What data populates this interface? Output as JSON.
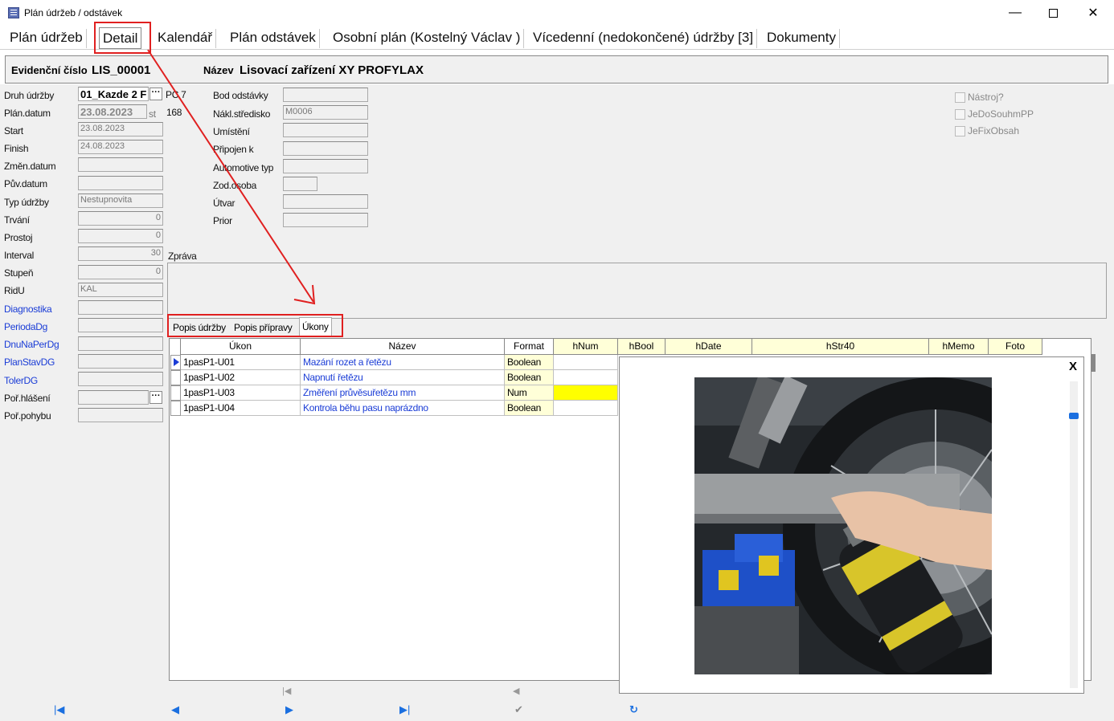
{
  "window": {
    "title": "Plán údržeb / odstávek",
    "min_glyph": "—",
    "close_glyph": "✕"
  },
  "main_tabs": [
    {
      "label": "Plán údržeb"
    },
    {
      "label": "Detail"
    },
    {
      "label": "Kalendář"
    },
    {
      "label": "Plán odstávek"
    },
    {
      "label": "Osobní plán (Kostelný Václav )"
    },
    {
      "label": "Vícedenní (nedokončené) údržby [3]"
    },
    {
      "label": "Dokumenty"
    }
  ],
  "header": {
    "evid_label": "Evidenční číslo",
    "evid_value": "LIS_00001",
    "name_label": "Název",
    "name_value": "Lisovací zařízení XY PROFYLAX"
  },
  "left_fields": [
    {
      "label": "Druh údržby",
      "value": "01_Kazde 2 F"
    },
    {
      "label": "Plán.datum",
      "value": "23.08.2023"
    },
    {
      "label": "Start",
      "value": "23.08.2023"
    },
    {
      "label": "Finish",
      "value": "24.08.2023"
    },
    {
      "label": "Změn.datum",
      "value": ""
    },
    {
      "label": "Pův.datum",
      "value": ""
    },
    {
      "label": "Typ údržby",
      "value": "Nestupnovita"
    },
    {
      "label": "Trvání",
      "value": "0"
    },
    {
      "label": "Prostoj",
      "value": "0"
    },
    {
      "label": "Interval",
      "value": "30"
    },
    {
      "label": "Stupeň",
      "value": "0"
    },
    {
      "label": "RidU",
      "value": "KAL"
    },
    {
      "label": "Diagnostika",
      "value": ""
    },
    {
      "label": "PeriodaDg",
      "value": ""
    },
    {
      "label": "DnuNaPerDg",
      "value": ""
    },
    {
      "label": "PlanStavDG",
      "value": ""
    },
    {
      "label": "TolerDG",
      "value": ""
    },
    {
      "label": "Poř.hlášení",
      "value": ""
    },
    {
      "label": "Poř.pohybu",
      "value": ""
    }
  ],
  "extras": {
    "pc_label": "PC 7",
    "st_label": "st",
    "st_value": "168",
    "ellipsis": "···"
  },
  "mid_fields": [
    {
      "label": "Bod odstávky",
      "value": ""
    },
    {
      "label": "Nákl.středisko",
      "value": "M0006"
    },
    {
      "label": "Umístění",
      "value": ""
    },
    {
      "label": "Připojen k",
      "value": ""
    },
    {
      "label": "Automotive typ",
      "value": ""
    },
    {
      "label": "Zod.osoba",
      "value": ""
    },
    {
      "label": "Útvar",
      "value": ""
    },
    {
      "label": "Prior",
      "value": ""
    }
  ],
  "checkboxes": [
    {
      "label": "Nástroj?"
    },
    {
      "label": "JeDoSouhmPP"
    },
    {
      "label": "JeFixObsah"
    }
  ],
  "zprava_label": "Zpráva",
  "sub_tabs": [
    {
      "label": "Popis údržby"
    },
    {
      "label": "Popis přípravy"
    },
    {
      "label": "Úkony"
    }
  ],
  "grid": {
    "columns": [
      "Úkon",
      "Název",
      "Format",
      "hNum",
      "hBool",
      "hDate",
      "hStr40",
      "hMemo",
      "Foto"
    ],
    "rows": [
      {
        "ukon": "1pasP1-U01",
        "nazev": "Mazání rozet a řetězu",
        "format": "Boolean"
      },
      {
        "ukon": "1pasP1-U02",
        "nazev": "Napnutí řetězu",
        "format": "Boolean"
      },
      {
        "ukon": "1pasP1-U03",
        "nazev": "Změření průvěsuřetězu mm",
        "format": "Num"
      },
      {
        "ukon": "1pasP1-U04",
        "nazev": "Kontrola běhu pasu naprázdno",
        "format": "Boolean"
      }
    ]
  },
  "popup": {
    "close_label": "X"
  },
  "nav": {
    "first": "|◀",
    "prev": "◀",
    "next": "▶",
    "last": "▶|",
    "pager_first": "|◀",
    "pager_prev": "◀",
    "confirm": "✔",
    "refresh": "↻"
  },
  "colors": {
    "accent": "#1a6fe0",
    "link_blue": "#1a3cd6",
    "annotation_red": "#e02020",
    "highlight_yellow": "#ffff00"
  }
}
